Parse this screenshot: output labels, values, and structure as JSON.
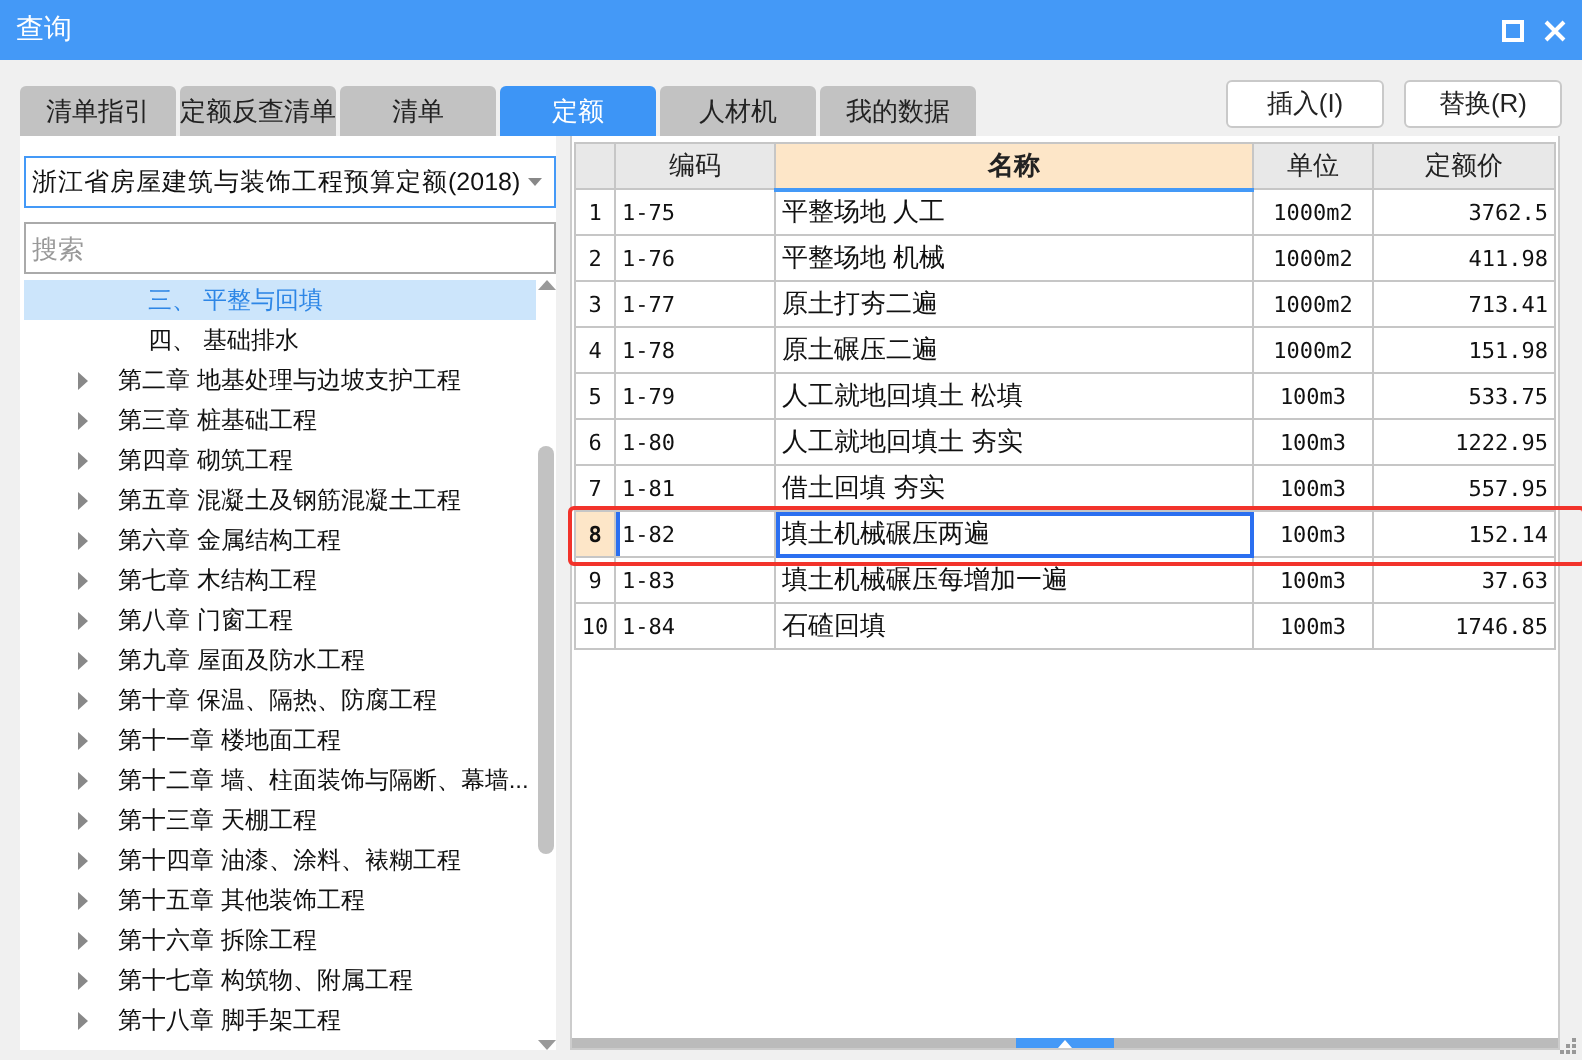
{
  "window": {
    "title": "查询"
  },
  "tabs": [
    {
      "label": "清单指引",
      "selected": false
    },
    {
      "label": "定额反查清单",
      "selected": false
    },
    {
      "label": "清单",
      "selected": false
    },
    {
      "label": "定额",
      "selected": true
    },
    {
      "label": "人材机",
      "selected": false
    },
    {
      "label": "我的数据",
      "selected": false
    }
  ],
  "buttons": [
    {
      "label": "插入(I)"
    },
    {
      "label": "替换(R)"
    }
  ],
  "quota_dropdown": {
    "value": "浙江省房屋建筑与装饰工程预算定额(2018)"
  },
  "search": {
    "placeholder": "搜索"
  },
  "tree": {
    "partial_group": [
      {
        "label": "三、 平整与回填",
        "selected": true
      },
      {
        "label": "四、 基础排水",
        "selected": false
      }
    ],
    "items": [
      {
        "label": "第二章 地基处理与边坡支护工程",
        "expanded": false,
        "selected": false
      },
      {
        "label": "第三章 桩基础工程",
        "expanded": false,
        "selected": false
      },
      {
        "label": "第四章 砌筑工程",
        "expanded": false,
        "selected": false
      },
      {
        "label": "第五章 混凝土及钢筋混凝土工程",
        "expanded": false,
        "selected": false
      },
      {
        "label": "第六章 金属结构工程",
        "expanded": false,
        "selected": false
      },
      {
        "label": "第七章 木结构工程",
        "expanded": false,
        "selected": false
      },
      {
        "label": "第八章 门窗工程",
        "expanded": false,
        "selected": false
      },
      {
        "label": "第九章 屋面及防水工程",
        "expanded": false,
        "selected": false
      },
      {
        "label": "第十章 保温、隔热、防腐工程",
        "expanded": false,
        "selected": false
      },
      {
        "label": "第十一章 楼地面工程",
        "expanded": false,
        "selected": false
      },
      {
        "label": "第十二章 墙、柱面装饰与隔断、幕墙...",
        "expanded": false,
        "selected": false
      },
      {
        "label": "第十三章 天棚工程",
        "expanded": false,
        "selected": false
      },
      {
        "label": "第十四章 油漆、涂料、裱糊工程",
        "expanded": false,
        "selected": false
      },
      {
        "label": "第十五章 其他装饰工程",
        "expanded": false,
        "selected": false
      },
      {
        "label": "第十六章 拆除工程",
        "expanded": false,
        "selected": false
      },
      {
        "label": "第十七章 构筑物、附属工程",
        "expanded": false,
        "selected": false
      },
      {
        "label": "第十八章 脚手架工程",
        "expanded": false,
        "selected": false
      }
    ]
  },
  "table": {
    "columns": [
      {
        "label": "编码",
        "selected": false
      },
      {
        "label": "名称",
        "selected": true
      },
      {
        "label": "单位",
        "selected": false
      },
      {
        "label": "定额价",
        "selected": false
      }
    ],
    "rows": [
      {
        "index": "1",
        "code": "1-75",
        "name": "平整场地 人工",
        "unit": "1000m2",
        "price": "3762.5",
        "selected": false,
        "marked": false
      },
      {
        "index": "2",
        "code": "1-76",
        "name": "平整场地 机械",
        "unit": "1000m2",
        "price": "411.98",
        "selected": false,
        "marked": false
      },
      {
        "index": "3",
        "code": "1-77",
        "name": "原土打夯二遍",
        "unit": "1000m2",
        "price": "713.41",
        "selected": false,
        "marked": false
      },
      {
        "index": "4",
        "code": "1-78",
        "name": "原土碾压二遍",
        "unit": "1000m2",
        "price": "151.98",
        "selected": false,
        "marked": false
      },
      {
        "index": "5",
        "code": "1-79",
        "name": "人工就地回填土 松填",
        "unit": "100m3",
        "price": "533.75",
        "selected": false,
        "marked": false
      },
      {
        "index": "6",
        "code": "1-80",
        "name": "人工就地回填土 夯实",
        "unit": "100m3",
        "price": "1222.95",
        "selected": false,
        "marked": false
      },
      {
        "index": "7",
        "code": "1-81",
        "name": "借土回填 夯实",
        "unit": "100m3",
        "price": "557.95",
        "selected": false,
        "marked": false
      },
      {
        "index": "8",
        "code": "1-82",
        "name": "填土机械碾压两遍",
        "unit": "100m3",
        "price": "152.14",
        "selected": true,
        "marked": true
      },
      {
        "index": "9",
        "code": "1-83",
        "name": "填土机械碾压每增加一遍",
        "unit": "100m3",
        "price": "37.63",
        "selected": false,
        "marked": false
      },
      {
        "index": "10",
        "code": "1-84",
        "name": "石碴回填",
        "unit": "100m3",
        "price": "1746.85",
        "selected": false,
        "marked": false
      }
    ]
  }
}
